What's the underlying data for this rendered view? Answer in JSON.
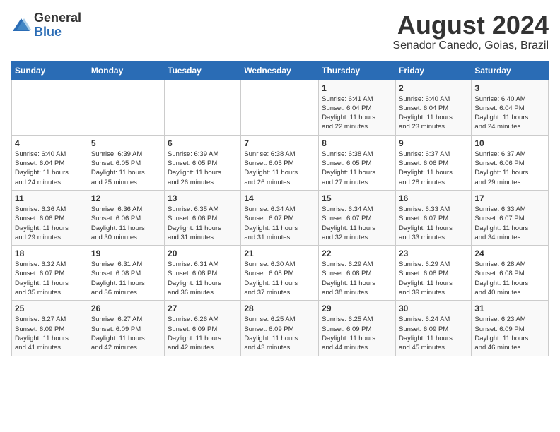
{
  "header": {
    "logo_general": "General",
    "logo_blue": "Blue",
    "month_title": "August 2024",
    "location": "Senador Canedo, Goias, Brazil"
  },
  "days_of_week": [
    "Sunday",
    "Monday",
    "Tuesday",
    "Wednesday",
    "Thursday",
    "Friday",
    "Saturday"
  ],
  "weeks": [
    [
      {
        "day": "",
        "info": ""
      },
      {
        "day": "",
        "info": ""
      },
      {
        "day": "",
        "info": ""
      },
      {
        "day": "",
        "info": ""
      },
      {
        "day": "1",
        "info": "Sunrise: 6:41 AM\nSunset: 6:04 PM\nDaylight: 11 hours\nand 22 minutes."
      },
      {
        "day": "2",
        "info": "Sunrise: 6:40 AM\nSunset: 6:04 PM\nDaylight: 11 hours\nand 23 minutes."
      },
      {
        "day": "3",
        "info": "Sunrise: 6:40 AM\nSunset: 6:04 PM\nDaylight: 11 hours\nand 24 minutes."
      }
    ],
    [
      {
        "day": "4",
        "info": "Sunrise: 6:40 AM\nSunset: 6:04 PM\nDaylight: 11 hours\nand 24 minutes."
      },
      {
        "day": "5",
        "info": "Sunrise: 6:39 AM\nSunset: 6:05 PM\nDaylight: 11 hours\nand 25 minutes."
      },
      {
        "day": "6",
        "info": "Sunrise: 6:39 AM\nSunset: 6:05 PM\nDaylight: 11 hours\nand 26 minutes."
      },
      {
        "day": "7",
        "info": "Sunrise: 6:38 AM\nSunset: 6:05 PM\nDaylight: 11 hours\nand 26 minutes."
      },
      {
        "day": "8",
        "info": "Sunrise: 6:38 AM\nSunset: 6:05 PM\nDaylight: 11 hours\nand 27 minutes."
      },
      {
        "day": "9",
        "info": "Sunrise: 6:37 AM\nSunset: 6:06 PM\nDaylight: 11 hours\nand 28 minutes."
      },
      {
        "day": "10",
        "info": "Sunrise: 6:37 AM\nSunset: 6:06 PM\nDaylight: 11 hours\nand 29 minutes."
      }
    ],
    [
      {
        "day": "11",
        "info": "Sunrise: 6:36 AM\nSunset: 6:06 PM\nDaylight: 11 hours\nand 29 minutes."
      },
      {
        "day": "12",
        "info": "Sunrise: 6:36 AM\nSunset: 6:06 PM\nDaylight: 11 hours\nand 30 minutes."
      },
      {
        "day": "13",
        "info": "Sunrise: 6:35 AM\nSunset: 6:06 PM\nDaylight: 11 hours\nand 31 minutes."
      },
      {
        "day": "14",
        "info": "Sunrise: 6:34 AM\nSunset: 6:07 PM\nDaylight: 11 hours\nand 31 minutes."
      },
      {
        "day": "15",
        "info": "Sunrise: 6:34 AM\nSunset: 6:07 PM\nDaylight: 11 hours\nand 32 minutes."
      },
      {
        "day": "16",
        "info": "Sunrise: 6:33 AM\nSunset: 6:07 PM\nDaylight: 11 hours\nand 33 minutes."
      },
      {
        "day": "17",
        "info": "Sunrise: 6:33 AM\nSunset: 6:07 PM\nDaylight: 11 hours\nand 34 minutes."
      }
    ],
    [
      {
        "day": "18",
        "info": "Sunrise: 6:32 AM\nSunset: 6:07 PM\nDaylight: 11 hours\nand 35 minutes."
      },
      {
        "day": "19",
        "info": "Sunrise: 6:31 AM\nSunset: 6:08 PM\nDaylight: 11 hours\nand 36 minutes."
      },
      {
        "day": "20",
        "info": "Sunrise: 6:31 AM\nSunset: 6:08 PM\nDaylight: 11 hours\nand 36 minutes."
      },
      {
        "day": "21",
        "info": "Sunrise: 6:30 AM\nSunset: 6:08 PM\nDaylight: 11 hours\nand 37 minutes."
      },
      {
        "day": "22",
        "info": "Sunrise: 6:29 AM\nSunset: 6:08 PM\nDaylight: 11 hours\nand 38 minutes."
      },
      {
        "day": "23",
        "info": "Sunrise: 6:29 AM\nSunset: 6:08 PM\nDaylight: 11 hours\nand 39 minutes."
      },
      {
        "day": "24",
        "info": "Sunrise: 6:28 AM\nSunset: 6:08 PM\nDaylight: 11 hours\nand 40 minutes."
      }
    ],
    [
      {
        "day": "25",
        "info": "Sunrise: 6:27 AM\nSunset: 6:09 PM\nDaylight: 11 hours\nand 41 minutes."
      },
      {
        "day": "26",
        "info": "Sunrise: 6:27 AM\nSunset: 6:09 PM\nDaylight: 11 hours\nand 42 minutes."
      },
      {
        "day": "27",
        "info": "Sunrise: 6:26 AM\nSunset: 6:09 PM\nDaylight: 11 hours\nand 42 minutes."
      },
      {
        "day": "28",
        "info": "Sunrise: 6:25 AM\nSunset: 6:09 PM\nDaylight: 11 hours\nand 43 minutes."
      },
      {
        "day": "29",
        "info": "Sunrise: 6:25 AM\nSunset: 6:09 PM\nDaylight: 11 hours\nand 44 minutes."
      },
      {
        "day": "30",
        "info": "Sunrise: 6:24 AM\nSunset: 6:09 PM\nDaylight: 11 hours\nand 45 minutes."
      },
      {
        "day": "31",
        "info": "Sunrise: 6:23 AM\nSunset: 6:09 PM\nDaylight: 11 hours\nand 46 minutes."
      }
    ]
  ]
}
